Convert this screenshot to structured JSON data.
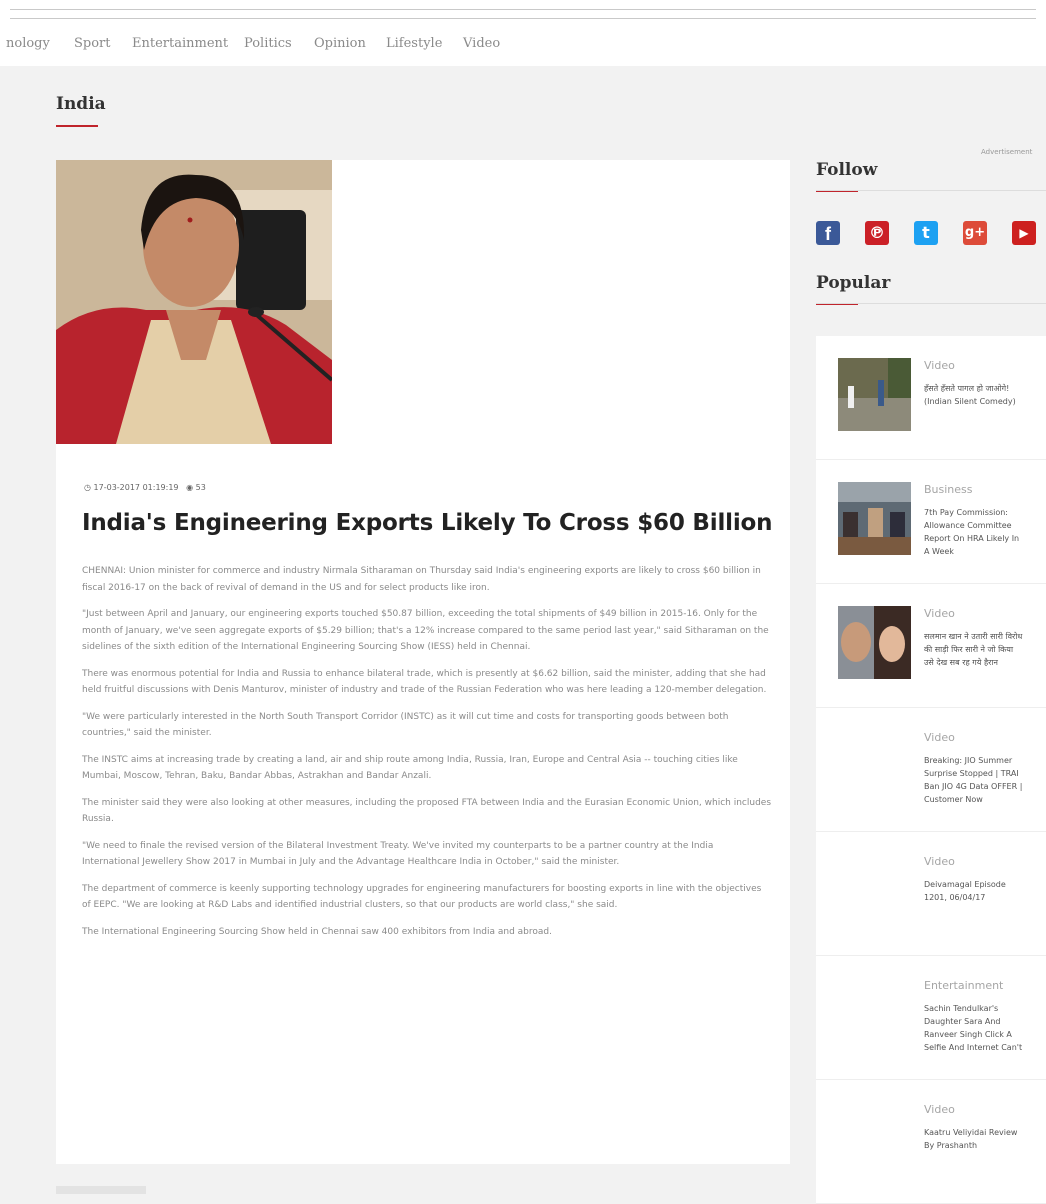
{
  "nav": {
    "items": [
      {
        "label": "nology"
      },
      {
        "label": "Sport"
      },
      {
        "label": "Entertainment"
      },
      {
        "label": "Politics"
      },
      {
        "label": "Opinion"
      },
      {
        "label": "Lifestyle"
      },
      {
        "label": "Video"
      }
    ]
  },
  "section": {
    "title": "India"
  },
  "article": {
    "date": "17-03-2017 01:19:19",
    "views": "53",
    "headline": "India's Engineering Exports Likely To Cross $60 Billion",
    "paragraphs": [
      "CHENNAI: Union minister for commerce and industry Nirmala Sitharaman on Thursday said India's engineering exports are likely to cross $60 billion in fiscal 2016-17 on the back of revival of demand in the US and for select products like iron.",
      "\"Just between April and January, our engineering exports touched $50.87 billion, exceeding the total shipments of $49 billion in 2015-16. Only for the month of January, we've seen aggregate exports of $5.29 billion; that's a 12% increase compared to the same period last year,\" said Sitharaman on the sidelines of the sixth edition of the International Engineering Sourcing Show (IESS) held in Chennai.",
      "There was enormous potential for India and Russia to enhance bilateral trade, which is presently at $6.62 billion, said the minister, adding that she had held fruitful discussions with Denis Manturov, minister of industry and trade of the Russian Federation who was here leading a 120-member delegation.",
      "\"We were particularly interested in the North South Transport Corridor (INSTC) as it will cut time and costs for transporting goods between both countries,\" said the minister.",
      "The INSTC aims at increasing trade by creating a land, air and ship route among India, Russia, Iran, Europe and Central Asia -- touching cities like Mumbai, Moscow, Tehran, Baku, Bandar Abbas, Astrakhan and Bandar Anzali.",
      "The minister said they were also looking at other measures, including the proposed FTA between India and the Eurasian Economic Union, which includes Russia.",
      "\"We need to finale the revised version of the Bilateral Investment Treaty. We've invited my counterparts to be a partner country at the India International Jewellery Show 2017 in Mumbai in July and the Advantage Healthcare India in October,\" said the minister.",
      "The department of commerce is keenly supporting technology upgrades for engineering manufacturers for boosting exports in line with the objectives of EEPC. \"We are looking at R&D Labs and identified industrial clusters, so that our products are world class,\" she said.",
      "The International Engineering Sourcing Show held in Chennai saw 400 exhibitors from India and abroad."
    ]
  },
  "sidebar": {
    "ad_label": "Advertisement",
    "follow_title": "Follow",
    "popular_title": "Popular",
    "social": [
      {
        "icon": "facebook-icon",
        "glyph": "f",
        "color": "#3b5998"
      },
      {
        "icon": "pinterest-icon",
        "glyph": "℗",
        "color": "#cb2027"
      },
      {
        "icon": "twitter-icon",
        "glyph": "t",
        "color": "#1da1f2"
      },
      {
        "icon": "google-plus-icon",
        "glyph": "g+",
        "color": "#dd4b39"
      },
      {
        "icon": "youtube-icon",
        "glyph": "▶",
        "color": "#cd201f"
      }
    ],
    "popular": [
      {
        "category": "Video",
        "title": "हँसते हँसते पागल हो जाओगे! (Indian Silent Comedy)"
      },
      {
        "category": "Business",
        "title": "7th Pay Commission: Allowance Committee Report On HRA Likely In A Week"
      },
      {
        "category": "Video",
        "title": "सलमान खान ने उतारी सारी विरोध की साड़ी फिर सारी ने जो किया उसे देख सब रह गये हैरान"
      },
      {
        "category": "Video",
        "title": "Breaking: JIO Summer Surprise Stopped | TRAI Ban JIO 4G Data OFFER | Customer Now"
      },
      {
        "category": "Video",
        "title": "Deivamagal Episode 1201, 06/04/17"
      },
      {
        "category": "Entertainment",
        "title": "Sachin Tendulkar's Daughter Sara And Ranveer Singh Click A Selfie And Internet Can't Exhale. See Pic"
      },
      {
        "category": "Video",
        "title": "Kaatru Veliyidai Review By Prashanth"
      }
    ]
  },
  "colors": {
    "accent": "#c0242c"
  }
}
